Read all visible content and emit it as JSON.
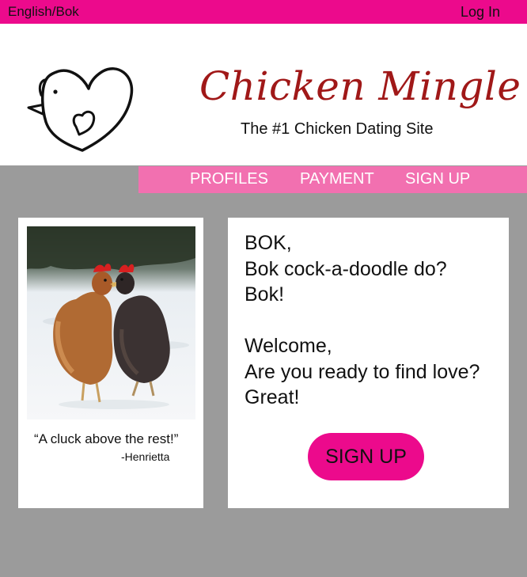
{
  "topbar": {
    "language": "English/Bok",
    "login": "Log In"
  },
  "header": {
    "brand": "Chicken Mingle",
    "tagline": "The #1 Chicken Dating Site"
  },
  "nav": {
    "items": [
      "PROFILES",
      "PAYMENT",
      "SIGN UP"
    ]
  },
  "testimonial": {
    "quote": "“A cluck above the rest!”",
    "author": "-Henrietta"
  },
  "welcome": {
    "lines": [
      "BOK,",
      "Bok cock-a-doodle do?",
      "Bok!",
      "",
      "Welcome,",
      "Are you ready to find love?",
      "Great!"
    ],
    "cta": "SIGN UP"
  },
  "colors": {
    "magenta": "#ec0a8c",
    "pink_nav": "#f270b0",
    "brand_red": "#a01818",
    "background": "#9b9b9b"
  },
  "icons": {
    "logo": "chicken-heart-logo-icon"
  }
}
